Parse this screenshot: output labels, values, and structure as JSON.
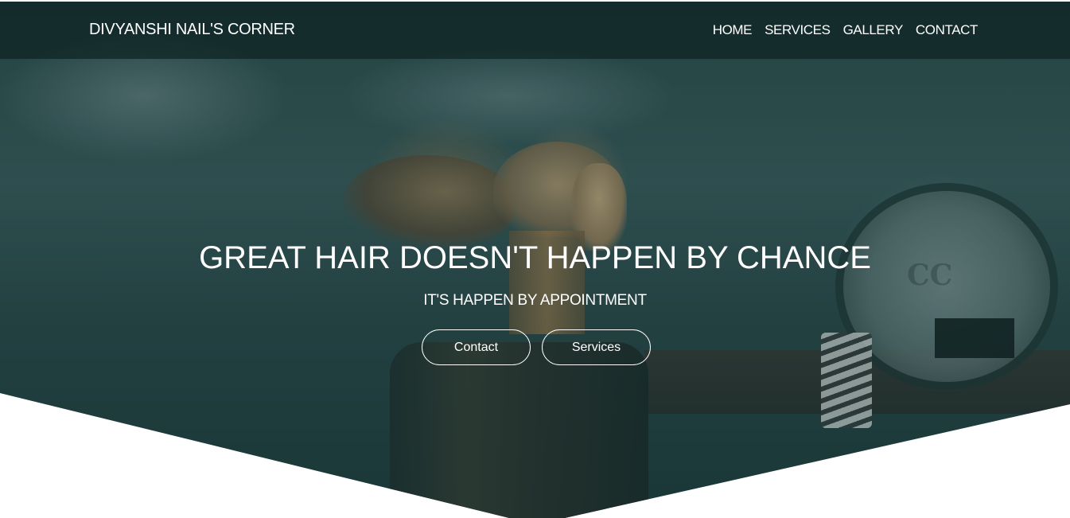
{
  "navbar": {
    "brand": "DIVYANSHI NAIL'S CORNER",
    "links": [
      {
        "label": "HOME"
      },
      {
        "label": "SERVICES"
      },
      {
        "label": "GALLERY"
      },
      {
        "label": "CONTACT"
      }
    ]
  },
  "hero": {
    "headline": "GREAT HAIR DOESN'T HAPPEN BY CHANCE",
    "subheadline": "IT'S HAPPEN BY APPOINTMENT",
    "buttons": {
      "contact_label": "Contact",
      "services_label": "Services"
    },
    "overlay_color": "#143737"
  }
}
